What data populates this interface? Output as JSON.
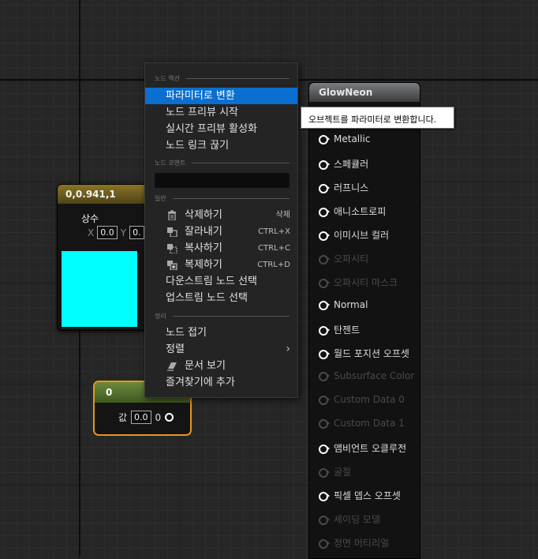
{
  "constant_node": {
    "title": "0,0.941,1",
    "label": "상수",
    "x_label": "X",
    "x_value": "0.0",
    "y_label": "Y",
    "y_value": "0.",
    "swatch_color": "#00ffff"
  },
  "scalar_node": {
    "title": "0",
    "value_label": "값",
    "value": "0.0",
    "output_label": "0"
  },
  "material_node": {
    "title": "GlowNeon",
    "pins": [
      {
        "label": "Metallic"
      },
      {
        "label": "스페큘러"
      },
      {
        "label": "러프니스"
      },
      {
        "label": "애니소트로피"
      },
      {
        "label": "이미시브 컬러"
      },
      {
        "label": "오파시티"
      },
      {
        "label": "오파시티 마스크"
      },
      {
        "label": "Normal"
      },
      {
        "label": "탄젠트"
      },
      {
        "label": "월드 포지션 오프셋"
      },
      {
        "label": "Subsurface Color"
      },
      {
        "label": "Custom Data 0"
      },
      {
        "label": "Custom Data 1"
      },
      {
        "label": "앰비언트 오클루전"
      },
      {
        "label": "굴절"
      },
      {
        "label": "픽셀 뎁스 오프셋"
      },
      {
        "label": "셰이딩 모델"
      },
      {
        "label": "정면 머티리얼"
      }
    ]
  },
  "tooltip": {
    "text": "오브젝트를 파라미터로 변환합니다."
  },
  "context_menu": {
    "section_node_actions": "노드 액션",
    "convert_to_parameter": "파라미터로 변환",
    "start_preview": "노드 프리뷰 시작",
    "enable_realtime_preview": "실시간 프리뷰 활성화",
    "break_node_links": "노드 링크 끊기",
    "section_node_comment": "노드 코멘트",
    "section_general": "일반",
    "delete": "삭제하기",
    "delete_shortcut": "삭제",
    "cut": "잘라내기",
    "cut_shortcut": "CTRL+X",
    "copy": "복사하기",
    "copy_shortcut": "CTRL+C",
    "duplicate": "복제하기",
    "duplicate_shortcut": "CTRL+D",
    "select_downstream": "다운스트림 노드 선택",
    "select_upstream": "업스트림 노드 선택",
    "section_organization": "정리",
    "collapse_node": "노드 접기",
    "align": "정렬",
    "view_documentation": "문서 보기",
    "add_to_favorites": "즐겨찾기에 추가"
  }
}
